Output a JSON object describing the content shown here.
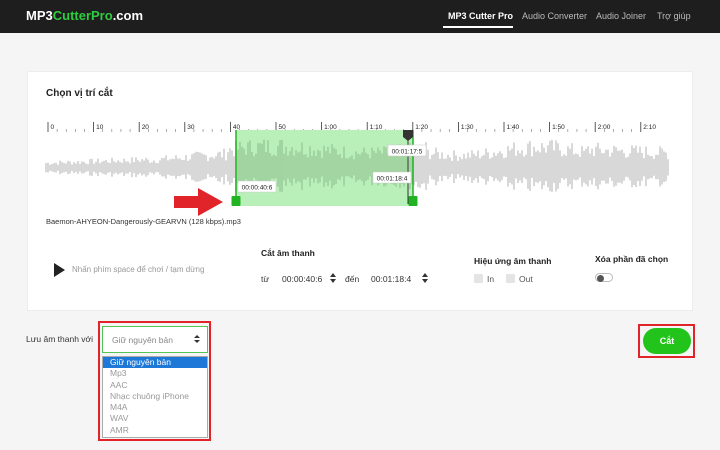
{
  "header": {
    "logo_part1": "MP3",
    "logo_part2": "CutterPro",
    "logo_part3": ".com",
    "nav": [
      "MP3 Cutter Pro",
      "Audio Converter",
      "Audio Joiner",
      "Trợ giúp"
    ],
    "active_nav": "MP3 Cutter Pro"
  },
  "editor": {
    "title": "Chọn vị trí cắt",
    "ruler_labels": [
      "0",
      "10",
      "20",
      "30",
      "40",
      "50",
      "1:00",
      "1:10",
      "1:20",
      "1:30",
      "1:40",
      "1:50",
      "2:00",
      "2:10"
    ],
    "selection_start_time": "00:00:40:6",
    "selection_end_time": "00:01:18:4",
    "playhead_time": "00:01:17:5",
    "filename": "Baemon-AHYEON-Dangerously-GEARVN (128 kbps).mp3",
    "selection_color": "#b9efb9",
    "handle_color": "#22b322",
    "wave_color": "#cfcfcf",
    "wave_selected_color": "#9dce9d",
    "arrow_color": "#e0242a"
  },
  "controls": {
    "play_hint": "Nhấn phím space để chơi / tạm dừng",
    "cut_section_title": "Cắt âm thanh",
    "from_label": "từ",
    "from_value": "00:00:40:6",
    "to_label": "đến",
    "to_value": "00:01:18:4",
    "effects_title": "Hiệu ứng âm thanh",
    "fade_in_label": "In",
    "fade_out_label": "Out",
    "delete_selected_title": "Xóa phần đã chọn"
  },
  "save": {
    "label": "Lưu âm thanh với",
    "selected_value": "Giữ nguyên bản",
    "options": [
      "Giữ nguyên bản",
      "Mp3",
      "AAC",
      "Nhạc chuông iPhone",
      "M4A",
      "WAV",
      "AMR"
    ],
    "highlighted_option": "Giữ nguyên bản",
    "cut_button": "Cắt"
  }
}
